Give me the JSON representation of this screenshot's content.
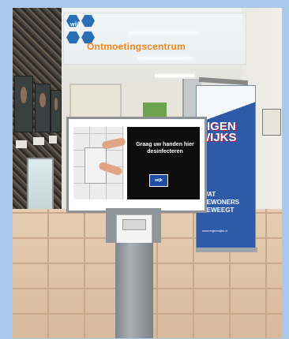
{
  "scene": {
    "glass_sign": {
      "logo_text": "wijk",
      "text": "Ontmoetingscentrum"
    },
    "banner": {
      "brand": "EIGEN WIJKS",
      "tagline": "WAT BEWONERS BEWEEGT",
      "url": "www.eigenwijks.nl"
    },
    "stand_poster": {
      "message": "Graag uw handen hier desinfecteren",
      "logo_text": "wijk"
    }
  },
  "colors": {
    "banner_blue": "#2e5aa8",
    "sign_orange": "#f2851a",
    "poster_black": "#0d0d0d"
  }
}
